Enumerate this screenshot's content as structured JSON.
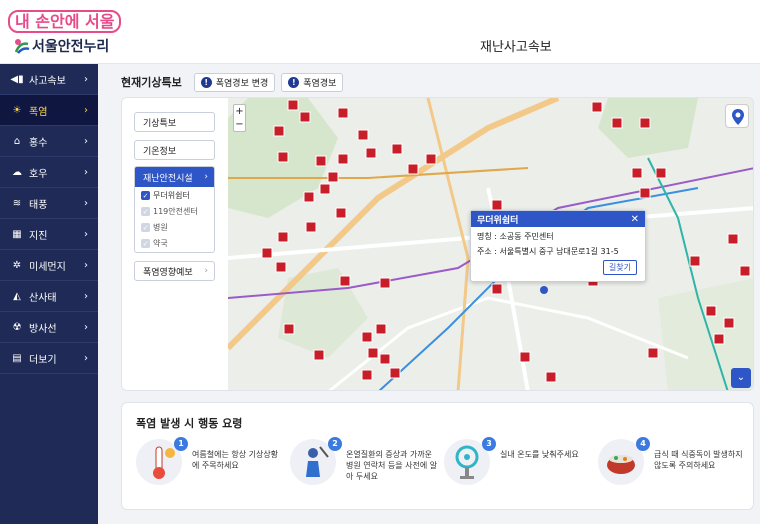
{
  "brand": {
    "top_logo": "내 손안에 서울",
    "sub_logo": "서울안전누리"
  },
  "page_title": "재난사고속보",
  "sidebar": {
    "items": [
      {
        "label": "사고속보",
        "icon": "megaphone-icon",
        "glyph": "◀▮",
        "active": false
      },
      {
        "label": "폭염",
        "icon": "sun-icon",
        "glyph": "☀",
        "active": true
      },
      {
        "label": "홍수",
        "icon": "flood-icon",
        "glyph": "⌂",
        "active": false
      },
      {
        "label": "호우",
        "icon": "rain-cloud-icon",
        "glyph": "☁",
        "active": false
      },
      {
        "label": "태풍",
        "icon": "typhoon-icon",
        "glyph": "≋",
        "active": false
      },
      {
        "label": "지진",
        "icon": "earthquake-icon",
        "glyph": "▦",
        "active": false
      },
      {
        "label": "미세먼지",
        "icon": "dust-icon",
        "glyph": "✲",
        "active": false
      },
      {
        "label": "산사태",
        "icon": "landslide-icon",
        "glyph": "◭",
        "active": false
      },
      {
        "label": "방사선",
        "icon": "radiation-icon",
        "glyph": "☢",
        "active": false
      },
      {
        "label": "더보기",
        "icon": "more-icon",
        "glyph": "▤",
        "active": false
      }
    ]
  },
  "alert_bar": {
    "title": "현재기상특보",
    "buttons": [
      {
        "label": "폭염경보 변경"
      },
      {
        "label": "폭염경보"
      }
    ]
  },
  "map_panel": {
    "weather_alert": "기상특보",
    "weather_info": "기온정보",
    "shelter_group": "재난안전시설",
    "options": [
      {
        "label": "무더위쉼터",
        "checked": true
      },
      {
        "label": "119안전센터",
        "checked": false
      },
      {
        "label": "병원",
        "checked": false
      },
      {
        "label": "약국",
        "checked": false
      }
    ],
    "forecast": "폭염영향예보"
  },
  "map_controls": {
    "zoom_in": "+",
    "zoom_out": "−",
    "expand": "⌄"
  },
  "popup": {
    "title": "무더위쉼터",
    "name_line": "명칭 : 소공동 주민센터",
    "addr_line": "주소 : 서울특별시 중구 남대문로1길 31-5",
    "button": "길찾기"
  },
  "action_guide": {
    "title": "폭염 발생 시 행동 요령",
    "items": [
      {
        "num": "1",
        "text": "여름철에는 항상 기상상황에 주목하세요",
        "icon": "thermometer-icon"
      },
      {
        "num": "2",
        "text": "온열질환의 증상과 가까운 병원 연락처 등을 사전에 알아 두세요",
        "icon": "person-umbrella-icon"
      },
      {
        "num": "3",
        "text": "실내 온도를 낮춰주세요",
        "icon": "fan-icon"
      },
      {
        "num": "4",
        "text": "급식 때 식중독이 발생하지 않도록 주의하세요",
        "icon": "food-pot-icon"
      }
    ]
  },
  "colors": {
    "sidebar": "#1f2a56",
    "accent": "#2f56c6",
    "active_text": "#ffd84a",
    "marker": "#c81e2a"
  }
}
